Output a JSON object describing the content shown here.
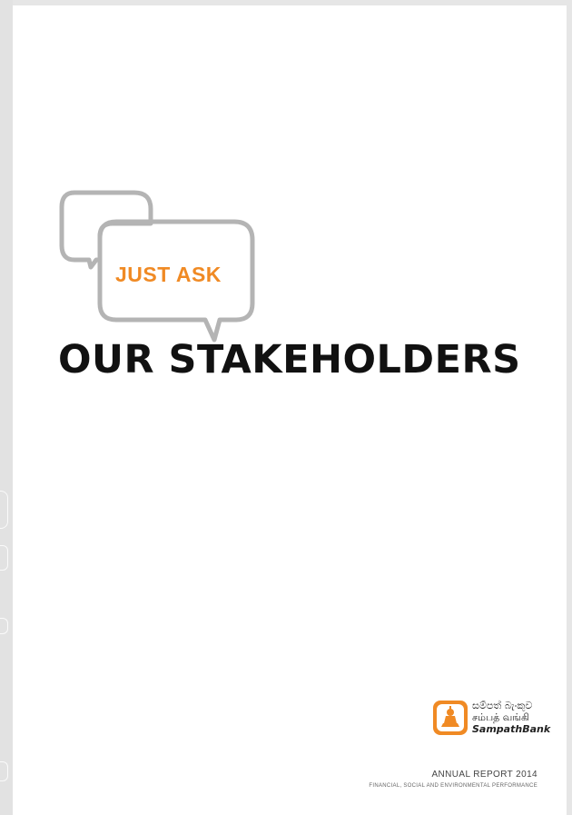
{
  "cover": {
    "tagline": "JUST ASK",
    "headline": "OUR STAKEHOLDERS"
  },
  "logo": {
    "sinhala": "සම්පත් බැංකුව",
    "tamil": "சம்பத் வங்கி",
    "brand": "SampathBank"
  },
  "report": {
    "title": "ANNUAL REPORT 2014",
    "subtitle": "FINANCIAL, SOCIAL AND ENVIRONMENTAL PERFORMANCE"
  },
  "colors": {
    "accent": "#f08a24",
    "bubble_stroke": "#b4b4b4",
    "headline": "#111111",
    "background": "#ffffff"
  }
}
